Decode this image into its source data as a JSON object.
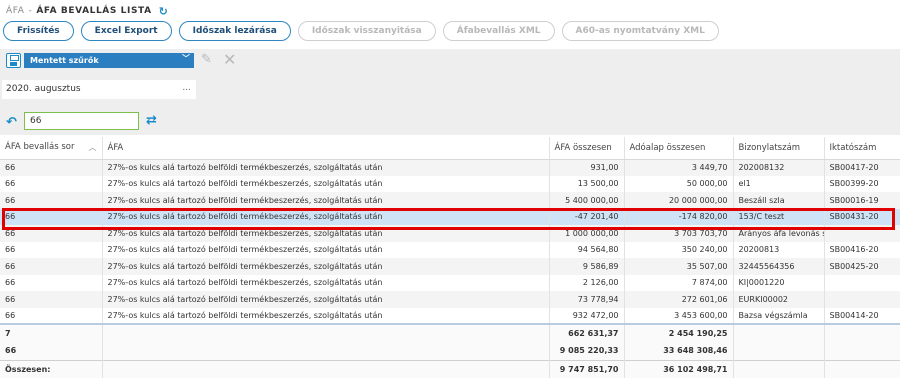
{
  "header": {
    "breadcrumb_parent": "ÁFA",
    "breadcrumb_sep": "-",
    "title": "ÁFA BEVALLÁS LISTA"
  },
  "toolbar": {
    "buttons": [
      {
        "label": "Frissítés",
        "enabled": true
      },
      {
        "label": "Excel Export",
        "enabled": true
      },
      {
        "label": "Időszak lezárása",
        "enabled": true
      },
      {
        "label": "Időszak visszanyitása",
        "enabled": false
      },
      {
        "label": "Áfabevallás XML",
        "enabled": false
      },
      {
        "label": "A60-as nyomtatvány XML",
        "enabled": false
      }
    ]
  },
  "filters": {
    "saved_filter_label": "Mentett szűrők",
    "period_value": "2020. augusztus",
    "period_dots": "...",
    "search_value": "66"
  },
  "table": {
    "columns": [
      "ÁFA bevallás sor",
      "ÁFA",
      "ÁFA összesen",
      "Adóalap összesen",
      "Bizonylatszám",
      "Iktatószám"
    ],
    "rows": [
      [
        "66",
        "27%-os kulcs alá tartozó belföldi termékbeszerzés, szolgáltatás után",
        "931,00",
        "3 449,70",
        "202008132",
        "SB00417-20"
      ],
      [
        "66",
        "27%-os kulcs alá tartozó belföldi termékbeszerzés, szolgáltatás után",
        "13 500,00",
        "50 000,00",
        "el1",
        "SB00399-20"
      ],
      [
        "66",
        "27%-os kulcs alá tartozó belföldi termékbeszerzés, szolgáltatás után",
        "5 400 000,00",
        "20 000 000,00",
        "Beszáll szla",
        "SB00016-19"
      ],
      [
        "66",
        "27%-os kulcs alá tartozó belföldi termékbeszerzés, szolgáltatás után",
        "-47 201,40",
        "-174 820,00",
        "153/C teszt",
        "SB00431-20"
      ],
      [
        "66",
        "27%-os kulcs alá tartozó belföldi termékbeszerzés, szolgáltatás után",
        "1 000 000,00",
        "3 703 703,70",
        "Arányos áfa levonás sz",
        ""
      ],
      [
        "66",
        "27%-os kulcs alá tartozó belföldi termékbeszerzés, szolgáltatás után",
        "94 564,80",
        "350 240,00",
        "20200813",
        "SB00416-20"
      ],
      [
        "66",
        "27%-os kulcs alá tartozó belföldi termékbeszerzés, szolgáltatás után",
        "9 586,89",
        "35 507,00",
        "32445564356",
        "SB00425-20"
      ],
      [
        "66",
        "27%-os kulcs alá tartozó belföldi termékbeszerzés, szolgáltatás után",
        "2 126,00",
        "7 874,00",
        "KI|0001220",
        ""
      ],
      [
        "66",
        "27%-os kulcs alá tartozó belföldi termékbeszerzés, szolgáltatás után",
        "73 778,94",
        "272 601,06",
        "EURKI00002",
        ""
      ],
      [
        "66",
        "27%-os kulcs alá tartozó belföldi termékbeszerzés, szolgáltatás után",
        "932 472,00",
        "3 453 600,00",
        "Bazsa végszámla",
        "SB00414-20"
      ]
    ],
    "selected_row": 3,
    "footer": [
      [
        "7",
        "",
        "662 631,37",
        "2 454 190,25",
        "",
        ""
      ],
      [
        "66",
        "",
        "9 085 220,33",
        "33 648 308,46",
        "",
        ""
      ],
      [
        "Összesen:",
        "",
        "9 747 851,70",
        "36 102 498,71",
        "",
        ""
      ]
    ]
  },
  "colors": {
    "accent": "#2b7fc1",
    "highlight": "#e00000",
    "selected_row": "#cfe3f6"
  }
}
